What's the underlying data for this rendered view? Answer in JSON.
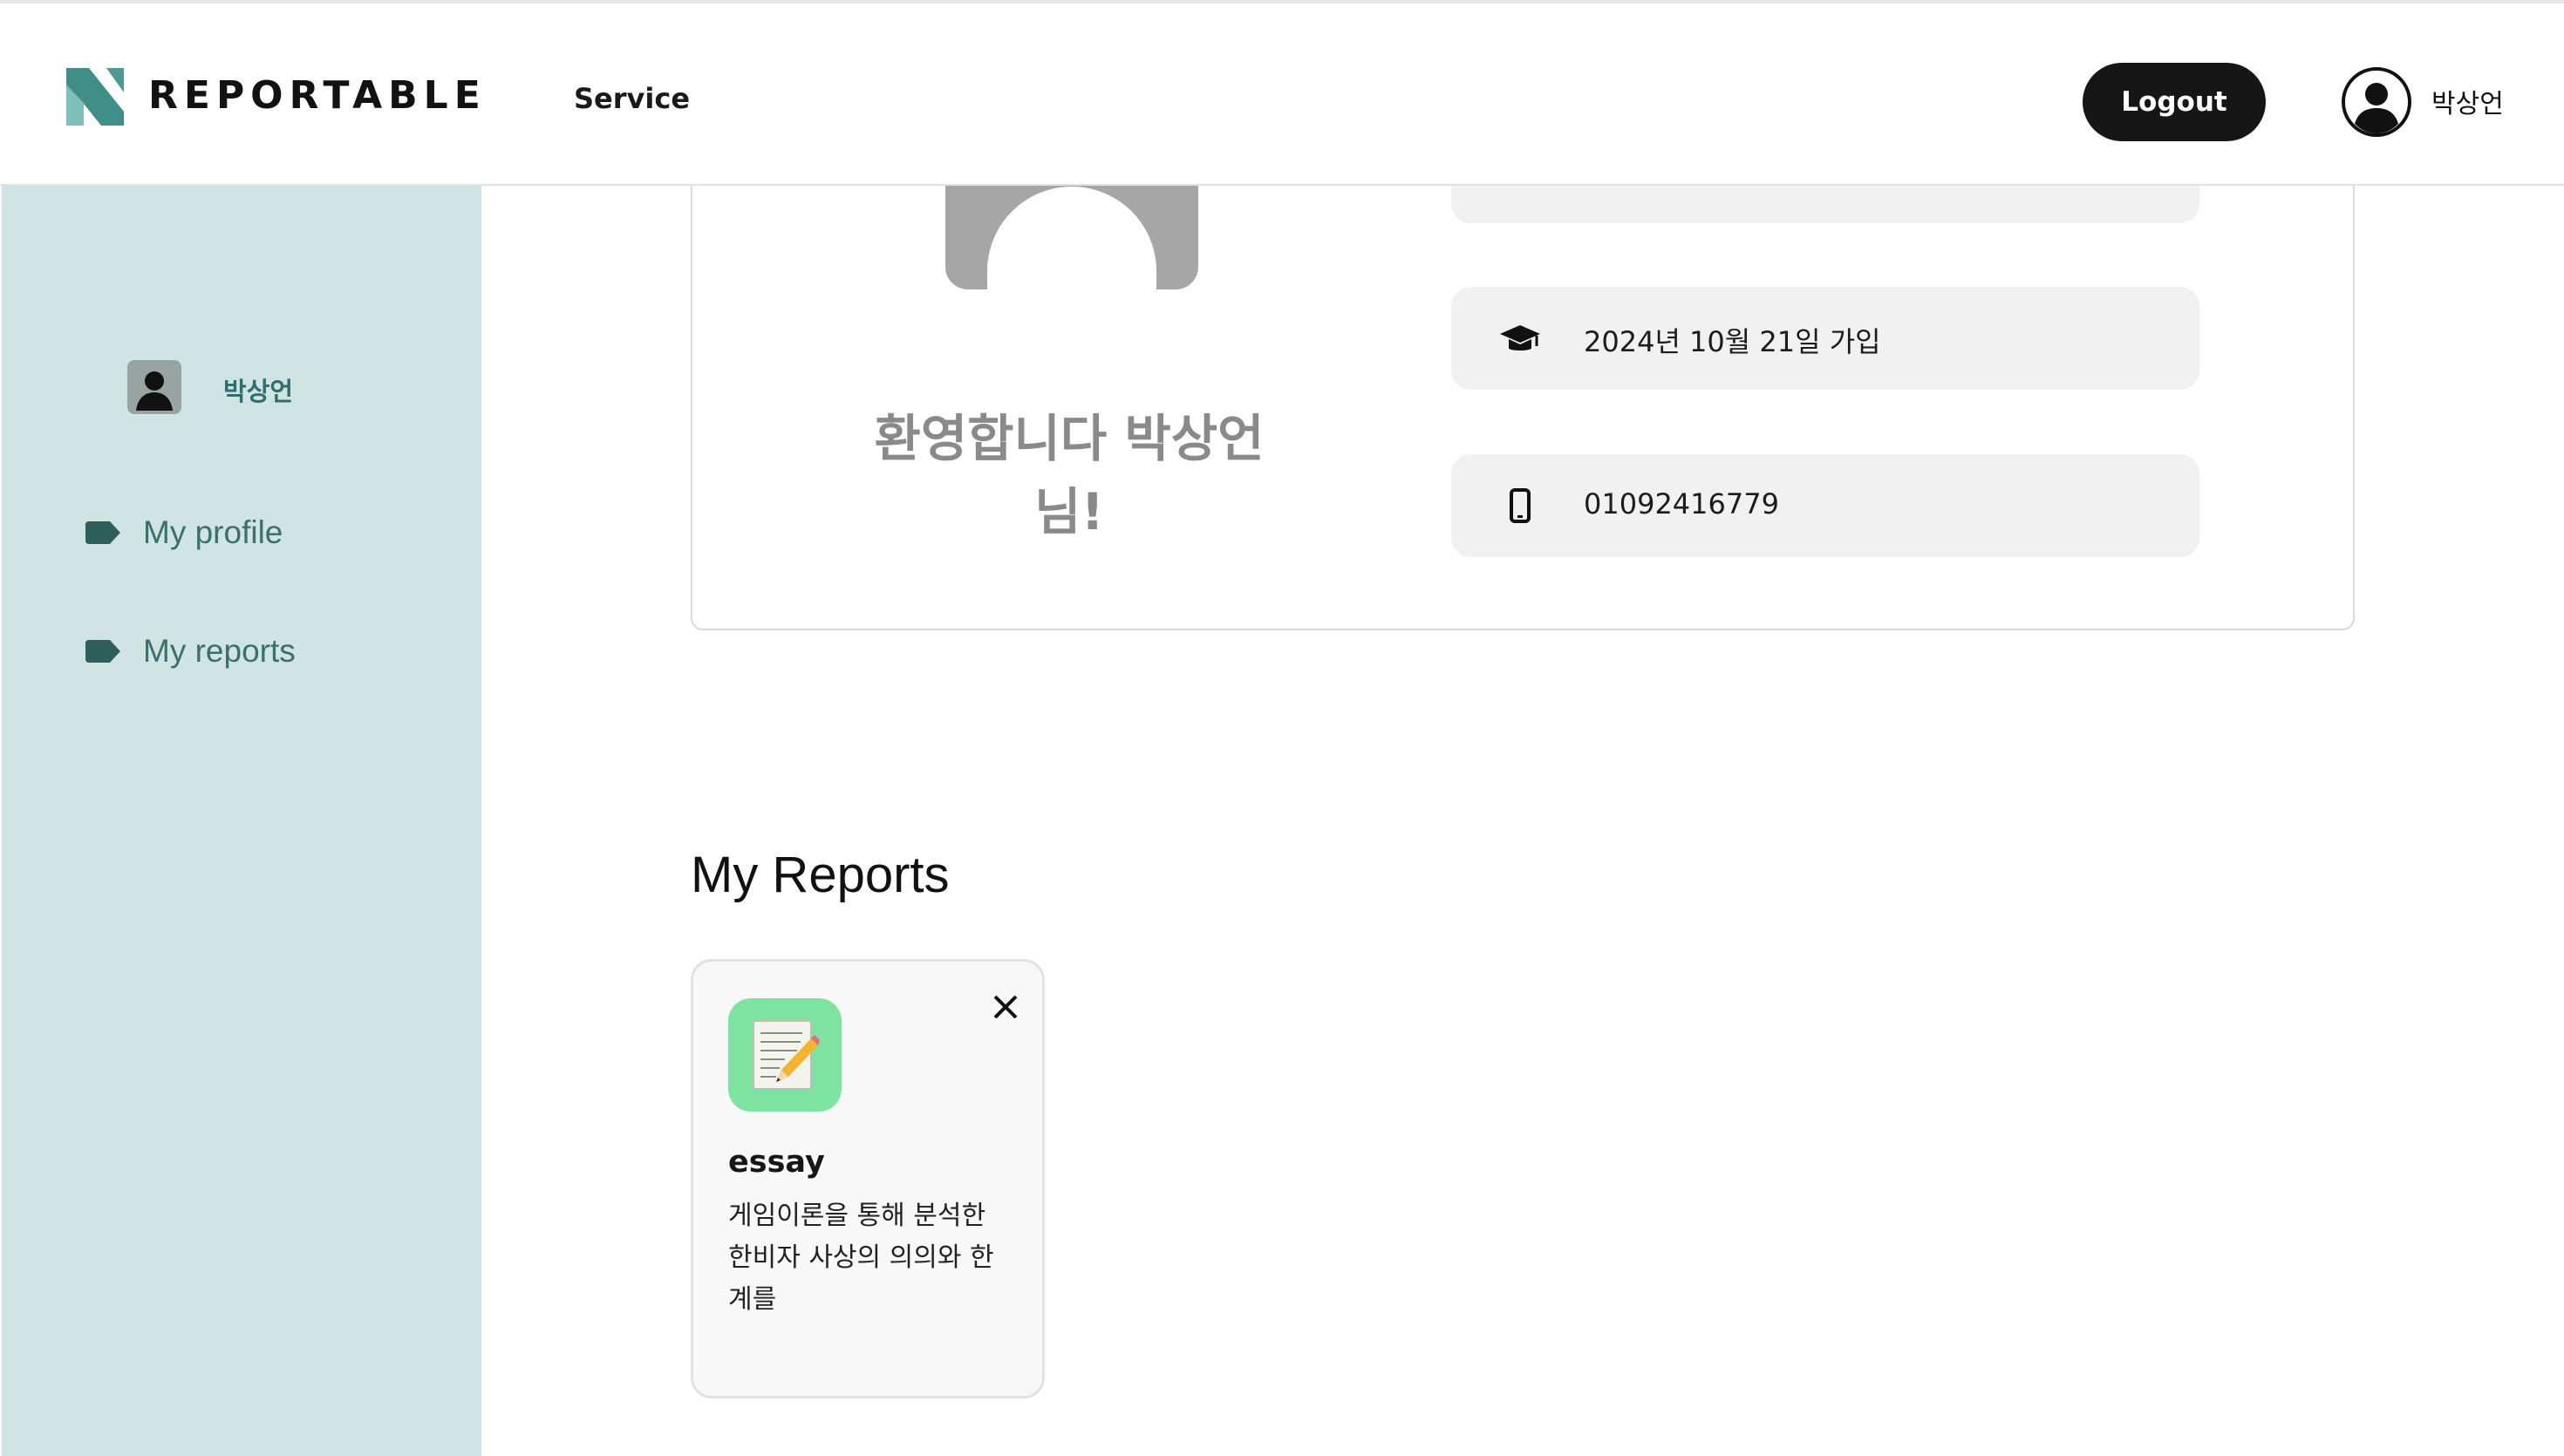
{
  "header": {
    "brand": "REPORTABLE",
    "nav_service": "Service",
    "logout_label": "Logout",
    "user_name": "박상언"
  },
  "sidebar": {
    "user_name": "박상언",
    "items": [
      {
        "label": "My profile",
        "icon": "tag-icon"
      },
      {
        "label": "My reports",
        "icon": "tag-icon"
      }
    ]
  },
  "profile": {
    "welcome": "환영합니다 박상언 님!",
    "joined": "2024년 10월 21일 가입",
    "phone": "01092416779"
  },
  "reports": {
    "title": "My Reports",
    "items": [
      {
        "name": "essay",
        "description": "게임이론을 통해 분석한 한비자 사상의 의의와 한계를",
        "icon": "memo-pencil-icon"
      }
    ]
  },
  "colors": {
    "sidebar_bg": "#d0e4e4",
    "sidebar_text": "#3c706c",
    "brand_teal": "#3f9a93",
    "report_icon_bg": "#7ee3a0",
    "logout_bg": "#161616"
  }
}
